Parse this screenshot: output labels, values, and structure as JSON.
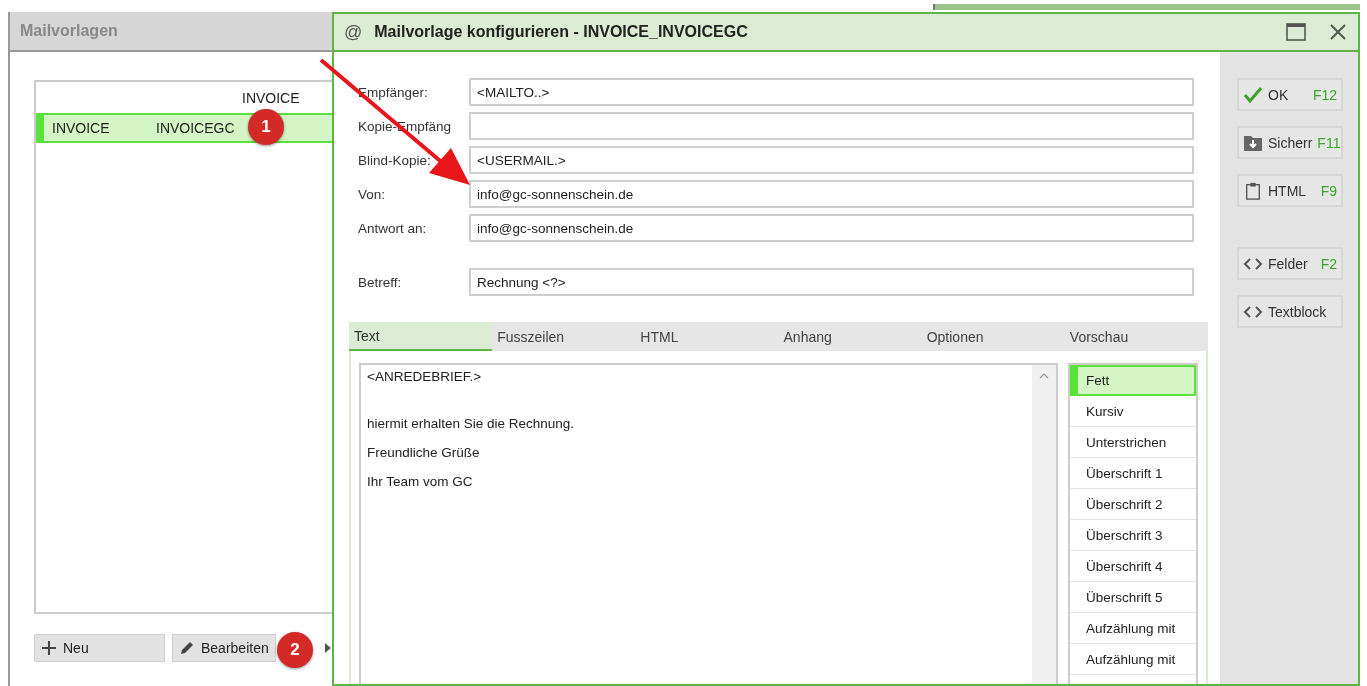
{
  "left_panel": {
    "title": "Mailvorlagen",
    "list": {
      "columns": [
        "INVOICE"
      ],
      "rows": [
        {
          "cells": [
            "INVOICE",
            "INVOICEGC"
          ],
          "selected": true
        }
      ]
    },
    "buttons": [
      {
        "label": "Neu"
      },
      {
        "label": "Bearbeiten"
      }
    ]
  },
  "dialog": {
    "title": "Mailvorlage konfigurieren - INVOICE_INVOICEGC",
    "title_icon": "@",
    "fields": [
      {
        "label": "Empfänger:",
        "value": "<MAILTO..>"
      },
      {
        "label": "Kopie-Empfäng"
      },
      {
        "label": "Blind-Kopie:",
        "value": "<USERMAIL.>"
      },
      {
        "label": "Von:",
        "value": "info@gc-sonnenschein.de"
      },
      {
        "label": "Antwort an:",
        "value": "info@gc-sonnenschein.de"
      },
      {
        "label": "Betreff:",
        "value": "Rechnung <?>"
      }
    ],
    "tabs": [
      {
        "label": "Text",
        "selected": true
      },
      {
        "label": "Fusszeilen",
        "selected": false
      },
      {
        "label": "HTML",
        "selected": false
      },
      {
        "label": "Anhang",
        "selected": false
      },
      {
        "label": "Optionen",
        "selected": false
      },
      {
        "label": "Vorschau",
        "selected": false
      }
    ],
    "editor_lines": [
      "<ANREDEBRIEF.>",
      "hiermit erhalten Sie die Rechnung.",
      "Freundliche Grüße",
      "Ihr Team vom GC"
    ],
    "styles": [
      {
        "label": "Fett",
        "selected": true
      },
      {
        "label": "Kursiv",
        "selected": false
      },
      {
        "label": "Unterstrichen",
        "selected": false
      },
      {
        "label": "Überschrift 1",
        "selected": false
      },
      {
        "label": "Überschrift 2",
        "selected": false
      },
      {
        "label": "Überschrift 3",
        "selected": false
      },
      {
        "label": "Überschrift 4",
        "selected": false
      },
      {
        "label": "Überschrift 5",
        "selected": false
      },
      {
        "label": "Aufzählung mit",
        "selected": false
      },
      {
        "label": "Aufzählung mit",
        "selected": false
      }
    ],
    "actions": [
      {
        "label": "OK",
        "key": "F12"
      },
      {
        "label": "Sicherr",
        "key": "F11"
      },
      {
        "label": "HTML",
        "key": "F9"
      },
      {
        "label": "Felder",
        "key": "F2"
      },
      {
        "label": "Textblock"
      }
    ]
  },
  "annotations": [
    {
      "number": "1"
    },
    {
      "number": "2"
    }
  ]
}
